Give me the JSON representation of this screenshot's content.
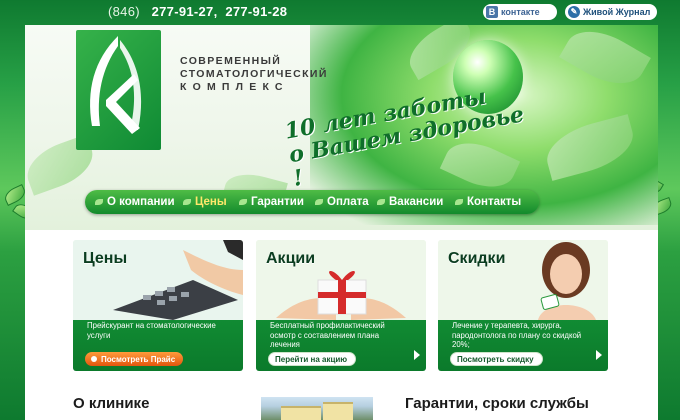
{
  "topbar": {
    "phone_code": "(846)",
    "phone_1": "277-91-27,",
    "phone_2": "277-91-28",
    "vk_icon": "В",
    "vk_label": "контакте",
    "lj_icon": "✎",
    "lj_label": "Живой Журнал"
  },
  "header": {
    "logo_icon": "leaf-logo-icon",
    "brand_lines": [
      "СОВРЕМЕННЫЙ",
      "СТОМАТОЛОГИЧЕСКИЙ",
      "КОМПЛЕКС"
    ],
    "slogan_line1": "10 лет заботы",
    "slogan_line2": "о Вашем здоровье !"
  },
  "nav": {
    "items": [
      {
        "label": "О компании"
      },
      {
        "label": "Цены"
      },
      {
        "label": "Гарантии"
      },
      {
        "label": "Оплата"
      },
      {
        "label": "Вакансии"
      },
      {
        "label": "Контакты"
      }
    ],
    "active_index": 1
  },
  "cards": [
    {
      "title": "Цены",
      "text": "Прейскурант на стоматологические услуги",
      "button": "Посмотреть Прайс",
      "style": "orange"
    },
    {
      "title": "Акции",
      "text": "Бесплатный профилактический осмотр с составлением плана лечения",
      "button": "Перейти на акцию",
      "style": "white"
    },
    {
      "title": "Скидки",
      "text": "Лечение у терапевта, хирурга, пародонтолога по плану со скидкой 20%;",
      "button": "Посмотреть скидку",
      "style": "white"
    }
  ],
  "sections": {
    "clinic_title": "О клинике",
    "guarantee_title": "Гарантии, сроки службы"
  },
  "colors": {
    "brand_green": "#1c8c3c",
    "nav_active": "#ffe86b",
    "price_button": "#ff7a22"
  }
}
